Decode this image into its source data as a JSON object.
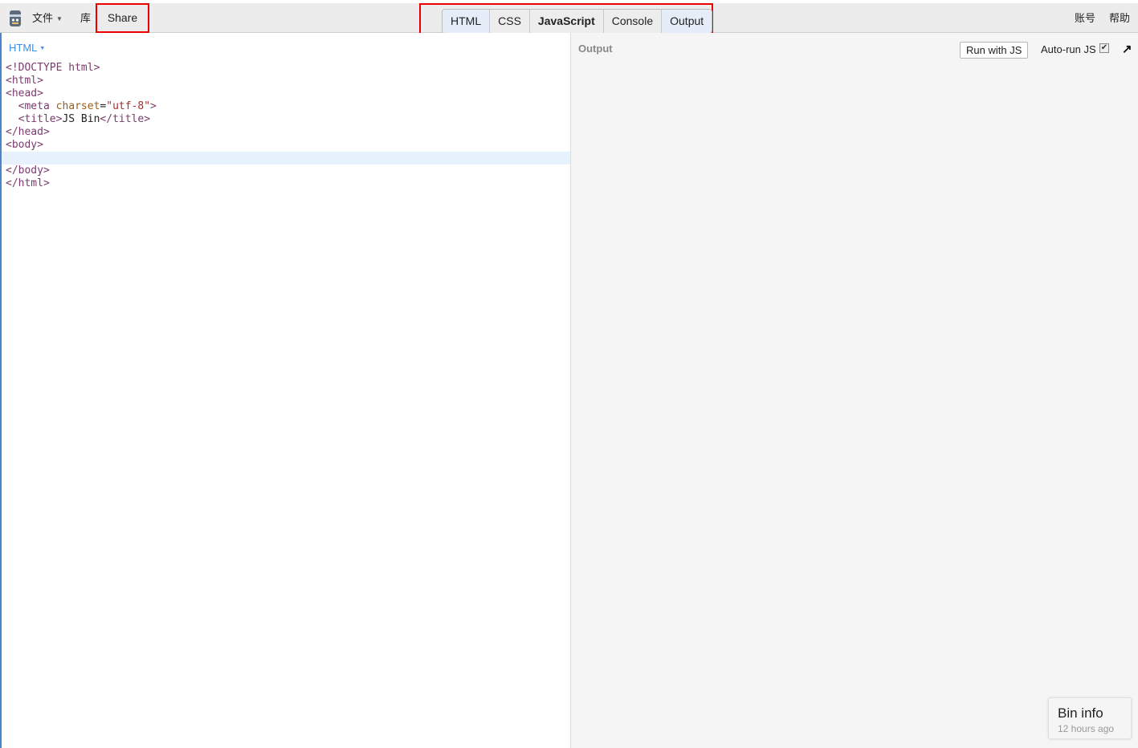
{
  "toolbar": {
    "logo_icon": "jsbin-logo-icon",
    "file_label": "文件",
    "library_label": "库",
    "share_label": "Share",
    "panels": [
      {
        "label": "HTML",
        "active": true
      },
      {
        "label": "CSS",
        "active": false
      },
      {
        "label": "JavaScript",
        "active": false
      },
      {
        "label": "Console",
        "active": false
      },
      {
        "label": "Output",
        "active": true
      }
    ],
    "account_label": "账号",
    "help_label": "帮助"
  },
  "editor": {
    "language_label": "HTML",
    "lines": [
      "<!DOCTYPE html>",
      "<html>",
      "<head>",
      "  <meta charset=\"utf-8\">",
      "  <title>JS Bin</title>",
      "</head>",
      "<body>",
      "",
      "</body>",
      "</html>"
    ],
    "token_parts": {
      "l3": [
        "  ",
        "<meta",
        " charset",
        "=",
        "\"utf-8\"",
        ">"
      ],
      "l4": [
        "  ",
        "<title>",
        "JS Bin",
        "</title>"
      ]
    }
  },
  "output": {
    "label": "Output",
    "run_label": "Run with JS",
    "autorun_label": "Auto-run JS",
    "autorun_checked": true,
    "popout_icon": "arrow-up-right-icon"
  },
  "bin_info": {
    "title": "Bin info",
    "time": "12 hours ago"
  },
  "colors": {
    "highlight": "#e00000",
    "active_tab": "#e4edf8",
    "editor_label": "#3a8ee6"
  }
}
